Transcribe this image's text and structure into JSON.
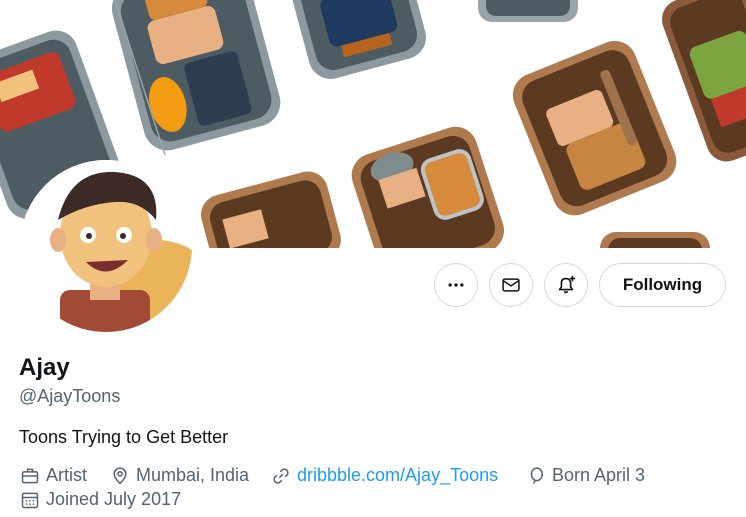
{
  "profile": {
    "display_name": "Ajay",
    "handle": "@AjayToons",
    "bio": "Toons Trying to Get Better",
    "job": "Artist",
    "location": "Mumbai, India",
    "website": "dribbble.com/Ajay_Toons",
    "birthday": "Born April 3",
    "joined": "Joined July 2017"
  },
  "actions": {
    "following_label": "Following"
  },
  "icons": {
    "more": "more-horizontal-icon",
    "message": "envelope-icon",
    "notify": "bell-plus-icon",
    "job": "briefcase-icon",
    "location": "map-pin-icon",
    "website": "link-icon",
    "birthday": "balloon-icon",
    "joined": "calendar-icon"
  },
  "colors": {
    "link": "#1d9bf0",
    "secondary_text": "#536471",
    "primary_text": "#0f1419",
    "border": "#cfd9de"
  }
}
